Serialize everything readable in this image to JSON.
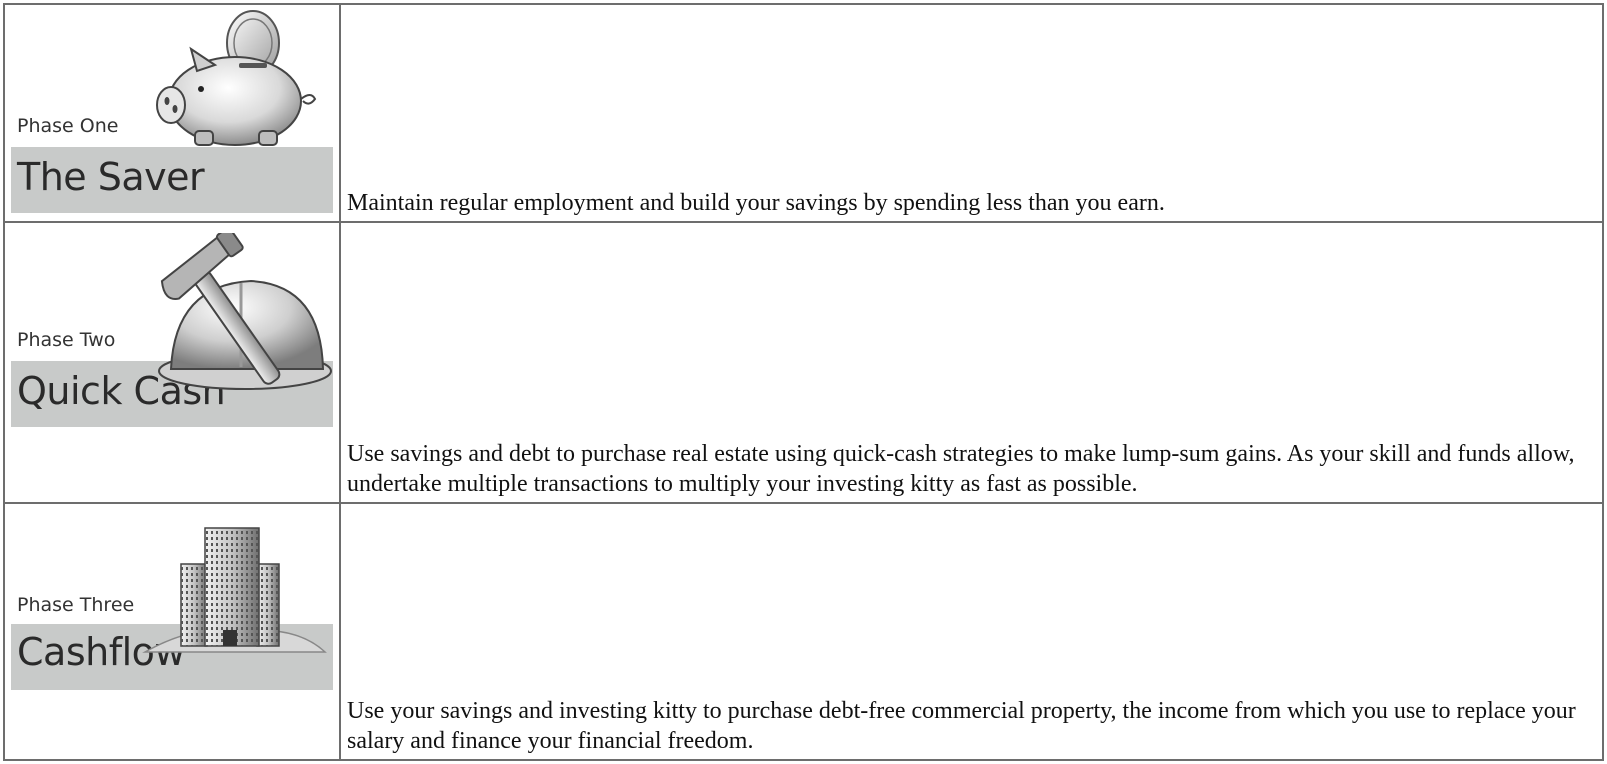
{
  "phases": [
    {
      "phase_label": "Phase One",
      "title": "The Saver",
      "icon": "piggy-bank-with-coin-icon",
      "description": "Maintain regular employment and build your savings by spending less than you earn."
    },
    {
      "phase_label": "Phase Two",
      "title": "Quick Cash",
      "icon": "hammer-and-hard-hat-icon",
      "description": "Use savings and debt to purchase real estate using quick-cash strategies to make lump-sum gains. As your skill and funds allow, undertake multiple transactions to multiply your investing kitty as fast as possible."
    },
    {
      "phase_label": "Phase Three",
      "title": "Cashflow",
      "icon": "office-building-icon",
      "description": "Use your savings and investing kitty to purchase debt-free commercial property, the income from which you use to replace your salary and finance your financial freedom."
    }
  ],
  "colors": {
    "banner": "#c8cac9",
    "border": "#6d6d6d",
    "text": "#111111"
  }
}
